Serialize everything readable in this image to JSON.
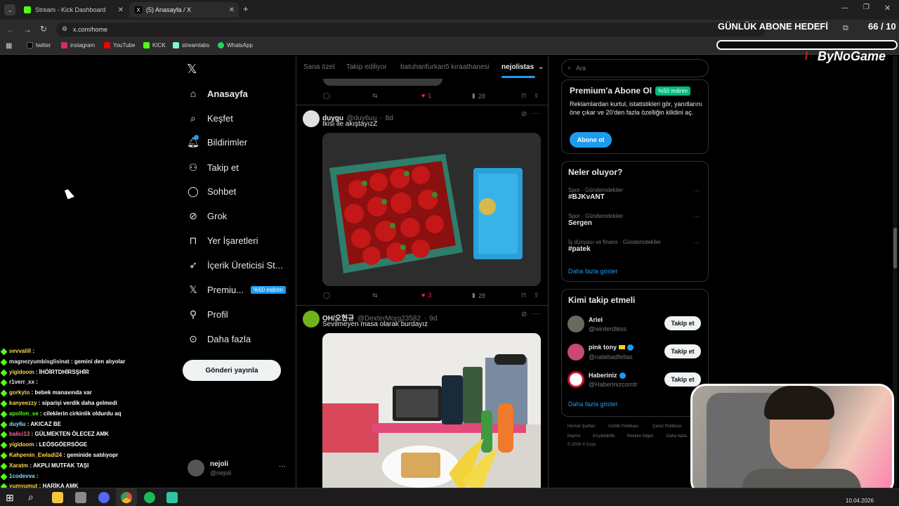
{
  "browser": {
    "tabs": [
      {
        "title": "Stream - Kick Dashboard",
        "active": false
      },
      {
        "title": "(5) Anasayfa / X",
        "active": true
      }
    ],
    "url": "x.com/home",
    "bookmarks": [
      "twitter",
      "instagram",
      "YouTube",
      "KICK",
      "streamlabs",
      "WhatsApp"
    ]
  },
  "overlay": {
    "goal_title": "GÜNLÜK ABONE HEDEFİ",
    "goal_count": "66 / 10",
    "brand": "ByNoGame",
    "progress_fraction": 1.0
  },
  "sidebar": {
    "items": [
      {
        "label": "Anasayfa",
        "icon": "home-icon"
      },
      {
        "label": "Keşfet",
        "icon": "search-icon"
      },
      {
        "label": "Bildirimler",
        "icon": "bell-icon"
      },
      {
        "label": "Takip et",
        "icon": "person-plus-icon"
      },
      {
        "label": "Sohbet",
        "icon": "chat-icon"
      },
      {
        "label": "Grok",
        "icon": "grok-icon"
      },
      {
        "label": "Yer İşaretleri",
        "icon": "bookmark-icon"
      },
      {
        "label": "İçerik Üreticisi St...",
        "icon": "rocket-icon"
      },
      {
        "label": "Premiu...",
        "icon": "x-icon"
      },
      {
        "label": "Profil",
        "icon": "profile-icon"
      },
      {
        "label": "Daha fazla",
        "icon": "more-icon"
      }
    ],
    "premium_badge": "%50 indirim",
    "post_button": "Gönderi yayınla",
    "account": {
      "name": "nejoli",
      "handle": "@nejoli"
    }
  },
  "timeline": {
    "tabs": [
      "Sana özel",
      "Takip ediliyor",
      "batuhanfurkan5 kıraathanesi",
      "nejolistas"
    ],
    "prev_actions": {
      "likes": "1",
      "views": "28"
    },
    "tweets": [
      {
        "name": "duygu",
        "handle": "@duy6uu",
        "time": "8d",
        "text": "İkisi ile akıştayızZ",
        "likes": "3",
        "views": "28"
      },
      {
        "name": "OH/오현규",
        "handle": "@DexterMorg23582",
        "time": "9d",
        "text": "Sevilmeyen masa olarak burdayız"
      }
    ]
  },
  "right": {
    "search_placeholder": "Ara",
    "premium": {
      "title": "Premium'a Abone Ol",
      "badge": "%50 indirim",
      "text": "Reklamlardan kurtul, istatistikleri gör, yanıtlarını öne çıkar ve 20'den fazla özelliğin kilidini aç.",
      "button": "Abone ol"
    },
    "trends": {
      "title": "Neler oluyor?",
      "items": [
        {
          "meta": "Spor · Gündemdekiler",
          "name": "#BJKvANT"
        },
        {
          "meta": "Spor · Gündemdekiler",
          "name": "Sergen"
        },
        {
          "meta": "İş dünyası ve finans · Gündemdekiler",
          "name": "#patek"
        }
      ],
      "more": "Daha fazla göster"
    },
    "who_to_follow": {
      "title": "Kimi takip etmeli",
      "items": [
        {
          "name": "Ariel",
          "handle": "@winterdless",
          "button": "Takip et"
        },
        {
          "name": "pink tony",
          "handle": "@natebadfellas",
          "button": "Takip et"
        },
        {
          "name": "Haberiniz",
          "handle": "@Haberinizcomtr",
          "button": "Takip et"
        }
      ],
      "more": "Daha fazla göster"
    },
    "footer": [
      "Hizmet Şartları",
      "Gizlilik Politikası",
      "Çerez Politikası",
      "İmprint",
      "Erişilebilirlik",
      "Reklam bilgisi",
      "Daha fazla",
      "© 2026 X Corp."
    ]
  },
  "chat": [
    {
      "user": "sevvalill",
      "msg": "",
      "color": "#ffd54f"
    },
    {
      "user": "magnezyumbisglisinat",
      "msg": "gemini den alıyolar",
      "color": "#e7e9ea"
    },
    {
      "user": "yigidoom",
      "msg": "İHÖİRTDHİRSŞHİR",
      "color": "#ffd54f"
    },
    {
      "user": "r1verr_xx",
      "msg": "",
      "color": "#e7e9ea"
    },
    {
      "user": "gorkyto",
      "msg": "bebek manavında var",
      "color": "#ffd54f"
    },
    {
      "user": "kanyeezzy",
      "msg": "siparişi verdik daha gelmedi",
      "color": "#ffd54f"
    },
    {
      "user": "apollon_se",
      "msg": "cileklerin cirkinlik oldurdu aq",
      "color": "#53fc18"
    },
    {
      "user": "duy6u",
      "msg": "AKICAZ BE",
      "color": "#7ee0ff"
    },
    {
      "user": "balici13",
      "msg": "GÜLMEKTEN ÖLECEZ AMK",
      "color": "#ff6b9a"
    },
    {
      "user": "yigidoom",
      "msg": "LEÖSGÖERSÖGE",
      "color": "#ffd54f"
    },
    {
      "user": "Kahpenin_Ewladi24",
      "msg": "geminide satılıyopr",
      "color": "#ffd54f"
    },
    {
      "user": "Xaratm",
      "msg": "AKPLI MUTFAK TAŞI",
      "color": "#ffd54f"
    },
    {
      "user": "1codevva",
      "msg": "",
      "color": "#7ee0ff"
    },
    {
      "user": "yumyumut",
      "msg": "HARİKA AMK",
      "color": "#ffd54f"
    }
  ],
  "taskbar": {
    "date": "10.04.2026"
  }
}
